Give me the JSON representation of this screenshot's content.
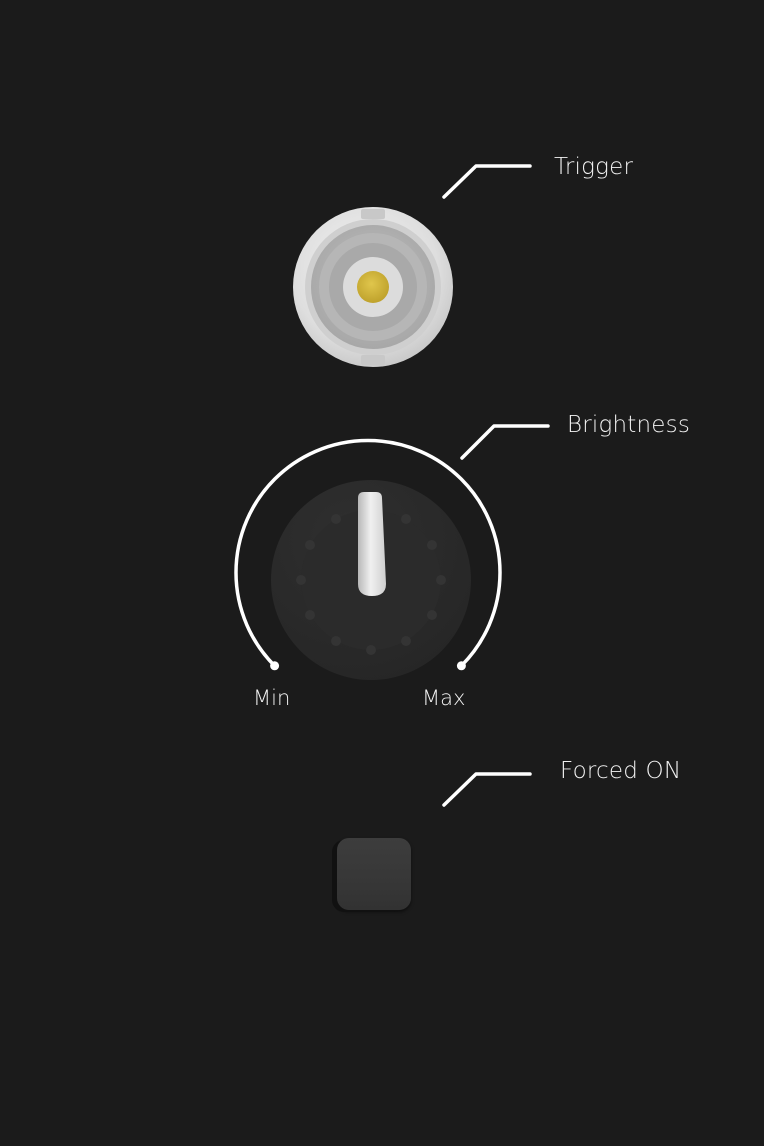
{
  "panel": {
    "background": "#1b1b1b",
    "trigger": {
      "label": "Trigger",
      "icon": "bnc-connector-icon",
      "pin_color": "#d1b43a"
    },
    "brightness": {
      "label": "Brightness",
      "min_label": "Min",
      "max_label": "Max",
      "level": 0.5,
      "icon": "rotary-knob-icon"
    },
    "forced_on": {
      "label": "Forced ON",
      "icon": "push-button-icon"
    }
  }
}
